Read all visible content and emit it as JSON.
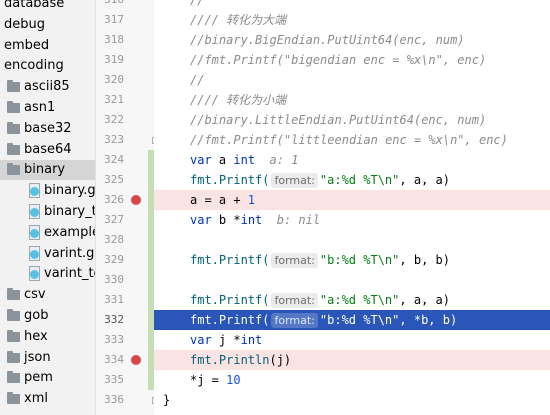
{
  "project_tree": {
    "items": [
      {
        "label": "database",
        "type": "none",
        "indent": 0
      },
      {
        "label": "debug",
        "type": "none",
        "indent": 0
      },
      {
        "label": "embed",
        "type": "none",
        "indent": 0
      },
      {
        "label": "encoding",
        "type": "none",
        "indent": 0
      },
      {
        "label": "ascii85",
        "type": "folder",
        "indent": 1
      },
      {
        "label": "asn1",
        "type": "folder",
        "indent": 1
      },
      {
        "label": "base32",
        "type": "folder",
        "indent": 1
      },
      {
        "label": "base64",
        "type": "folder",
        "indent": 1
      },
      {
        "label": "binary",
        "type": "folder",
        "indent": 1,
        "selected": true
      },
      {
        "label": "binary.go",
        "type": "gofile",
        "indent": 2
      },
      {
        "label": "binary_test.go",
        "type": "gofile",
        "indent": 2
      },
      {
        "label": "example_test.go",
        "type": "gofile",
        "indent": 2
      },
      {
        "label": "varint.go",
        "type": "gofile",
        "indent": 2
      },
      {
        "label": "varint_test.go",
        "type": "gofile",
        "indent": 2
      },
      {
        "label": "csv",
        "type": "folder",
        "indent": 1
      },
      {
        "label": "gob",
        "type": "folder",
        "indent": 1
      },
      {
        "label": "hex",
        "type": "folder",
        "indent": 1
      },
      {
        "label": "json",
        "type": "folder",
        "indent": 1
      },
      {
        "label": "pem",
        "type": "folder",
        "indent": 1
      },
      {
        "label": "xml",
        "type": "folder",
        "indent": 1
      }
    ]
  },
  "gutter": {
    "line_numbers": [
      "316",
      "317",
      "318",
      "319",
      "320",
      "321",
      "322",
      "323",
      "324",
      "325",
      "326",
      "327",
      "328",
      "329",
      "330",
      "331",
      "332",
      "333",
      "334",
      "335",
      "336"
    ],
    "breakpoints": [
      "326",
      "334"
    ],
    "current_line": "332"
  },
  "editor": {
    "lines": [
      {
        "n": "316",
        "state": "normal",
        "segs": [
          {
            "c": "cmt",
            "t": "//"
          }
        ]
      },
      {
        "n": "317",
        "state": "normal",
        "segs": [
          {
            "c": "cmt",
            "t": "//// 转化为大端"
          }
        ]
      },
      {
        "n": "318",
        "state": "normal",
        "segs": [
          {
            "c": "cmt",
            "t": "//binary.BigEndian.PutUint64(enc, num)"
          }
        ]
      },
      {
        "n": "319",
        "state": "normal",
        "segs": [
          {
            "c": "cmt",
            "t": "//fmt.Printf(\"bigendian enc = %x\\n\", enc)"
          }
        ]
      },
      {
        "n": "320",
        "state": "normal",
        "segs": [
          {
            "c": "cmt",
            "t": "//"
          }
        ]
      },
      {
        "n": "321",
        "state": "normal",
        "segs": [
          {
            "c": "cmt",
            "t": "//// 转化为小端"
          }
        ]
      },
      {
        "n": "322",
        "state": "normal",
        "segs": [
          {
            "c": "cmt",
            "t": "//binary.LittleEndian.PutUint64(enc, num)"
          }
        ]
      },
      {
        "n": "323",
        "state": "normal",
        "segs": [
          {
            "c": "cmt",
            "t": "//fmt.Printf(\"littleendian enc = %x\\n\", enc)"
          }
        ]
      },
      {
        "n": "324",
        "state": "normal",
        "segs": [
          {
            "c": "kw",
            "t": "var"
          },
          {
            "c": "",
            "t": " a "
          },
          {
            "c": "kw",
            "t": "int"
          },
          {
            "c": "",
            "t": "  "
          },
          {
            "c": "inlay",
            "t": "a: 1"
          }
        ]
      },
      {
        "n": "325",
        "state": "normal",
        "segs": [
          {
            "c": "fn",
            "t": "fmt.Printf("
          },
          {
            "c": "hint",
            "t": "format:"
          },
          {
            "c": "str",
            "t": "\"a:%d %T\\n\""
          },
          {
            "c": "",
            "t": ", a, a)"
          }
        ]
      },
      {
        "n": "326",
        "state": "bp",
        "segs": [
          {
            "c": "",
            "t": "a = a + "
          },
          {
            "c": "num",
            "t": "1"
          }
        ]
      },
      {
        "n": "327",
        "state": "normal",
        "segs": [
          {
            "c": "kw",
            "t": "var"
          },
          {
            "c": "",
            "t": " b *"
          },
          {
            "c": "kw",
            "t": "int"
          },
          {
            "c": "",
            "t": "  "
          },
          {
            "c": "inlay",
            "t": "b: nil"
          }
        ]
      },
      {
        "n": "328",
        "state": "normal",
        "segs": []
      },
      {
        "n": "329",
        "state": "normal",
        "segs": [
          {
            "c": "fn",
            "t": "fmt.Printf("
          },
          {
            "c": "hint",
            "t": "format:"
          },
          {
            "c": "str",
            "t": "\"b:%d %T\\n\""
          },
          {
            "c": "",
            "t": ", b, b)"
          }
        ]
      },
      {
        "n": "330",
        "state": "normal",
        "segs": []
      },
      {
        "n": "331",
        "state": "normal",
        "segs": [
          {
            "c": "fn",
            "t": "fmt.Printf("
          },
          {
            "c": "hint",
            "t": "format:"
          },
          {
            "c": "str",
            "t": "\"a:%d %T\\n\""
          },
          {
            "c": "",
            "t": ", a, a)"
          }
        ]
      },
      {
        "n": "332",
        "state": "sel",
        "segs": [
          {
            "c": "fn",
            "t": "fmt.Printf("
          },
          {
            "c": "hint",
            "t": "format:"
          },
          {
            "c": "str",
            "t": "\"b:%d %T\\n\""
          },
          {
            "c": "",
            "t": ", *b, b)"
          }
        ]
      },
      {
        "n": "333",
        "state": "normal",
        "segs": [
          {
            "c": "kw",
            "t": "var"
          },
          {
            "c": "",
            "t": " j *"
          },
          {
            "c": "kw",
            "t": "int"
          }
        ]
      },
      {
        "n": "334",
        "state": "bp",
        "segs": [
          {
            "c": "fn",
            "t": "fmt.Println"
          },
          {
            "c": "",
            "t": "(j)"
          }
        ]
      },
      {
        "n": "335",
        "state": "normal",
        "segs": [
          {
            "c": "",
            "t": "*j = "
          },
          {
            "c": "num",
            "t": "10"
          }
        ]
      },
      {
        "n": "336",
        "state": "normal",
        "segs": [
          {
            "c": "closing",
            "t": "}"
          }
        ]
      }
    ]
  },
  "colors": {
    "breakpoint": "#d74548",
    "selection": "#2a56b9",
    "breakpoint_line": "#fae3e3",
    "change_marker": "#c6deb6"
  }
}
